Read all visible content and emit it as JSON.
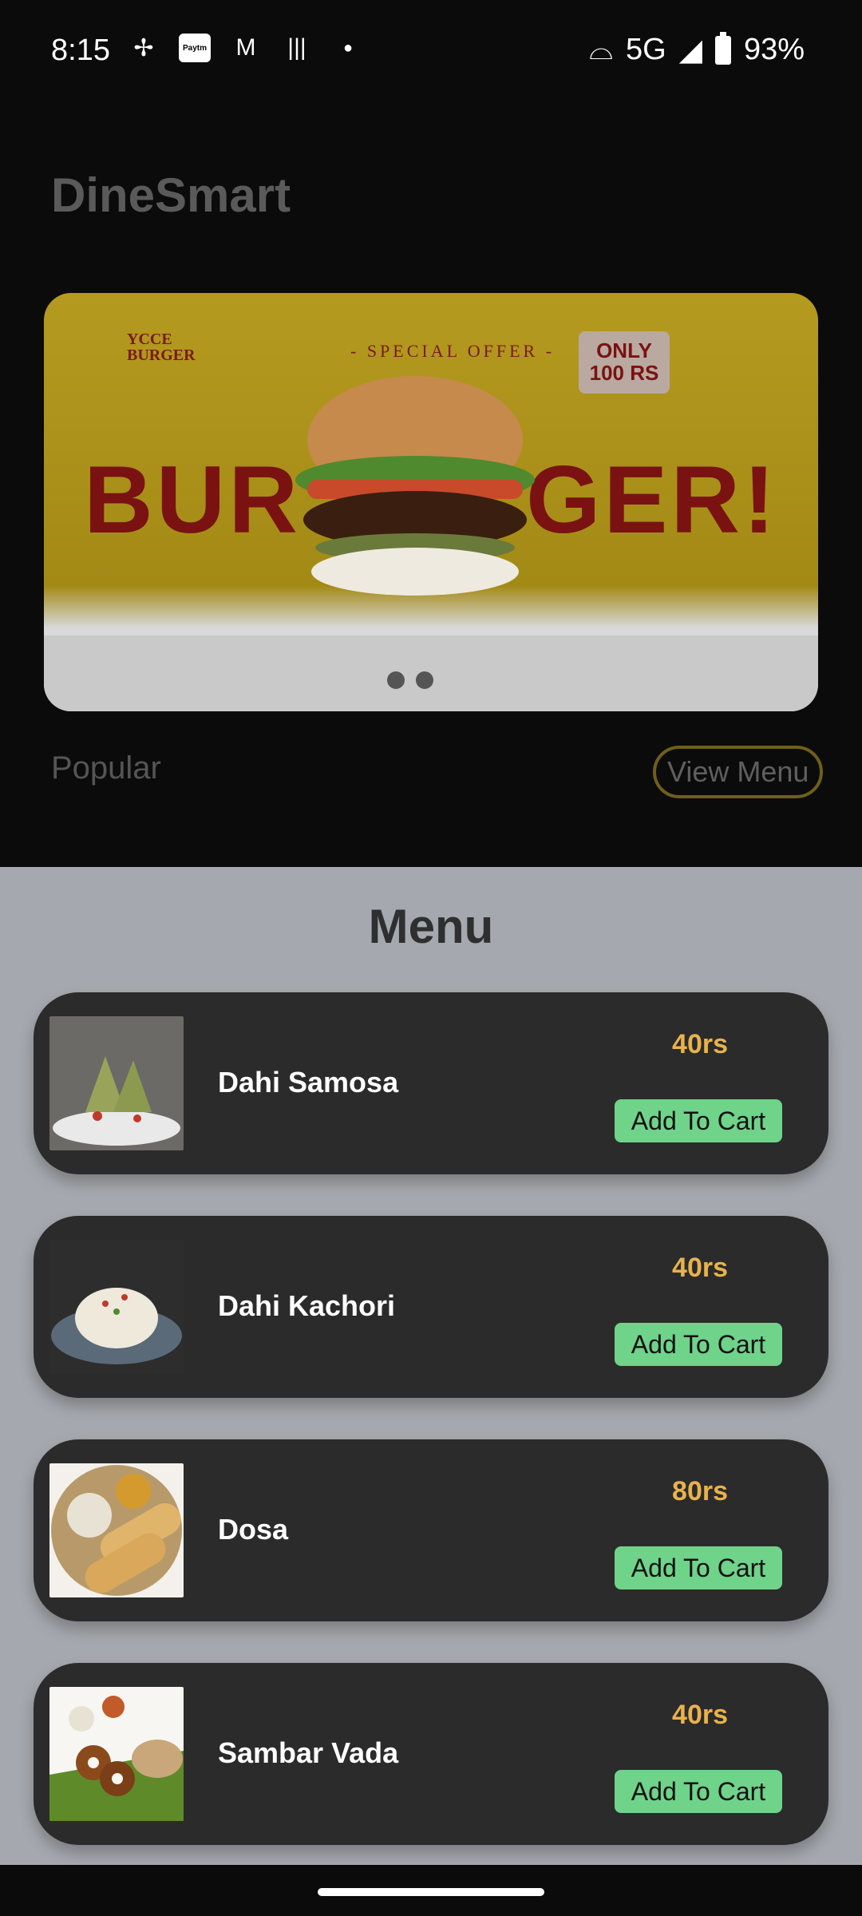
{
  "status_bar": {
    "time": "8:15",
    "network": "5G",
    "battery": "93%",
    "icons": [
      "pinwheel-icon",
      "paytm-icon",
      "gmail-icon",
      "voice-wave-icon",
      "dot-icon",
      "hotspot-icon",
      "signal-icon",
      "battery-icon"
    ]
  },
  "main": {
    "app_title": "DineSmart",
    "banner": {
      "brand_line1": "YCCE",
      "brand_line2": "BURGER",
      "offer_text": "- SPECIAL OFFER -",
      "badge_line1": "ONLY",
      "badge_line2": "100 RS",
      "headline_left": "BUR",
      "headline_right": "GER!",
      "dots_count": 2
    },
    "popular_label": "Popular",
    "view_menu_label": "View Menu"
  },
  "menu_sheet": {
    "title": "Menu",
    "items": [
      {
        "name": "Dahi Samosa",
        "price": "40rs",
        "button": "Add To Cart"
      },
      {
        "name": "Dahi Kachori",
        "price": "40rs",
        "button": "Add To Cart"
      },
      {
        "name": "Dosa",
        "price": "80rs",
        "button": "Add To Cart"
      },
      {
        "name": "Sambar Vada",
        "price": "40rs",
        "button": "Add To Cart"
      }
    ]
  },
  "colors": {
    "price": "#e9b24c",
    "add_button": "#6fd38a",
    "card": "#2b2b2b",
    "sheet": "#a5a8ae"
  }
}
